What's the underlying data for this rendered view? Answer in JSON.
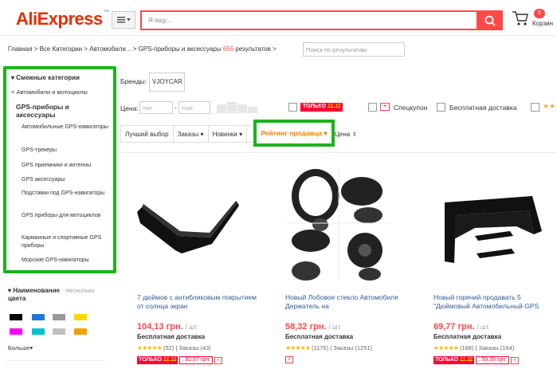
{
  "header": {
    "logo_text": "AliExpress",
    "search_placeholder": "Я ищу...",
    "cart_count": "5",
    "cart_label": "Корзин"
  },
  "breadcrumb": {
    "path": "Главная > Все Категории > Автомобили... > GPS-приборы и аксессуары",
    "count": "656",
    "results_label": "результатов >",
    "search_placeholder": "Поиск по результатам."
  },
  "sidebar": {
    "title": "Смежные категории",
    "parent": "< Автомобили и мотоциклы",
    "current": "GPS-приборы и аксессуары",
    "items": [
      "Автомобильные GPS-навигаторы",
      "GPS-трекеры",
      "GPS приемники и антенны",
      "GPS аксессуары",
      "Подставки под GPS-навигаторы",
      "GPS приборы для мотоциклов",
      "Карманные и спортивные GPS приборы",
      "Морские GPS-навигаторы"
    ],
    "color_title": "Наименование цвета",
    "color_hint": "Несколько",
    "colors": [
      "#000000",
      "#1a7bd4",
      "#999999",
      "#ffd700",
      "#ff00ff",
      "#00c0d0",
      "#c0c0c0",
      "#f0a000"
    ],
    "more_label": "Больше"
  },
  "filters": {
    "brand_label": "Бренды:",
    "brand_value": "VJOYCAR",
    "price_label": "Цена:",
    "price_min_placeholder": "min",
    "price_max_placeholder": "max",
    "only_label": "ТОЛЬКО",
    "only_date": "11.11",
    "coupon_label": "Спецкупон",
    "free_shipping_label": "Бесплатная доставка"
  },
  "sort": {
    "best": "Лучший выбор",
    "orders": "Заказы",
    "newest": "Новинки",
    "seller_rating": "Рейтинг продавца",
    "price": "Цена"
  },
  "products": [
    {
      "title": "7 дюймов с антибликовым покрытием от солнца экран",
      "price": "104,13 грн.",
      "unit": "/ шт.",
      "shipping": "Бесплатная доставка",
      "reviews": "(52)",
      "orders": "Заказы (43)",
      "promo_price": ": 92,67 грн."
    },
    {
      "title": "Новый Лобовое стекло Автомобиля Держатель на",
      "price": "58,32 грн.",
      "unit": "/ шт.",
      "shipping": "Бесплатная доставка",
      "reviews": "(1176)",
      "orders": "Заказы (1251)",
      "promo_price": ""
    },
    {
      "title": "Новый горячий продавать 5 \"Дюймовый Автомобильный GPS",
      "price": "69,77 грн.",
      "unit": "/ шт.",
      "shipping": "Бесплатная доставка",
      "reviews": "(168)",
      "orders": "Заказы (164)",
      "promo_price": ": 59,39 грн."
    }
  ]
}
